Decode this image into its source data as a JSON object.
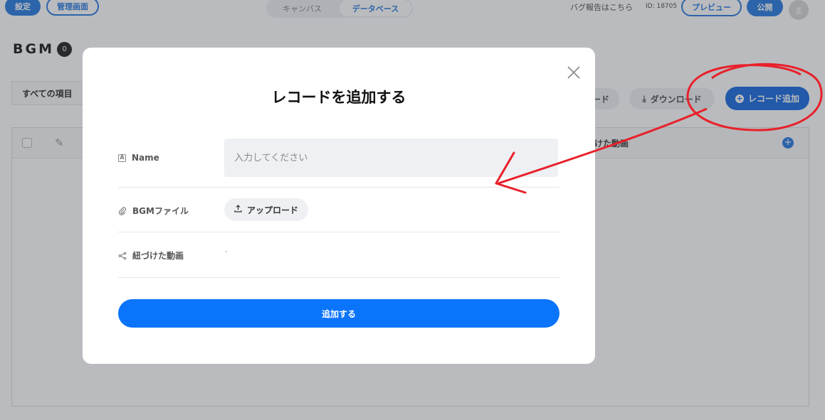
{
  "topbar": {
    "settings_label": "設定",
    "admin_label": "管理画面",
    "tabs": [
      {
        "label": "キャンバス",
        "active": false
      },
      {
        "label": "データベース",
        "active": true
      }
    ],
    "bug_report_label": "バグ報告はこちら",
    "id_label": "ID: 18705",
    "preview_label": "プレビュー",
    "publish_label": "公開",
    "avatar_initial": "ま"
  },
  "page": {
    "title": "BGM",
    "record_count": "0"
  },
  "toolbar": {
    "filter_label": "すべての項目",
    "upload_partial_label": "ード",
    "download_label": "ダウンロード",
    "add_record_label": "レコード追加"
  },
  "table": {
    "visible_column_label": "づけた動画",
    "add_column_symbol": "+"
  },
  "modal": {
    "title": "レコードを追加する",
    "fields": {
      "name": {
        "label": "Name",
        "placeholder": "入力してください"
      },
      "bgm_file": {
        "label": "BGMファイル",
        "upload_label": "アップロード"
      },
      "linked_videos": {
        "label": "紐づけた動画",
        "value": "-"
      }
    },
    "submit_label": "追加する"
  },
  "colors": {
    "primary": "#0a74fb",
    "accent_blue": "#2f7fe0",
    "annotation_red": "#e8202a",
    "input_bg": "#eef0f3"
  }
}
